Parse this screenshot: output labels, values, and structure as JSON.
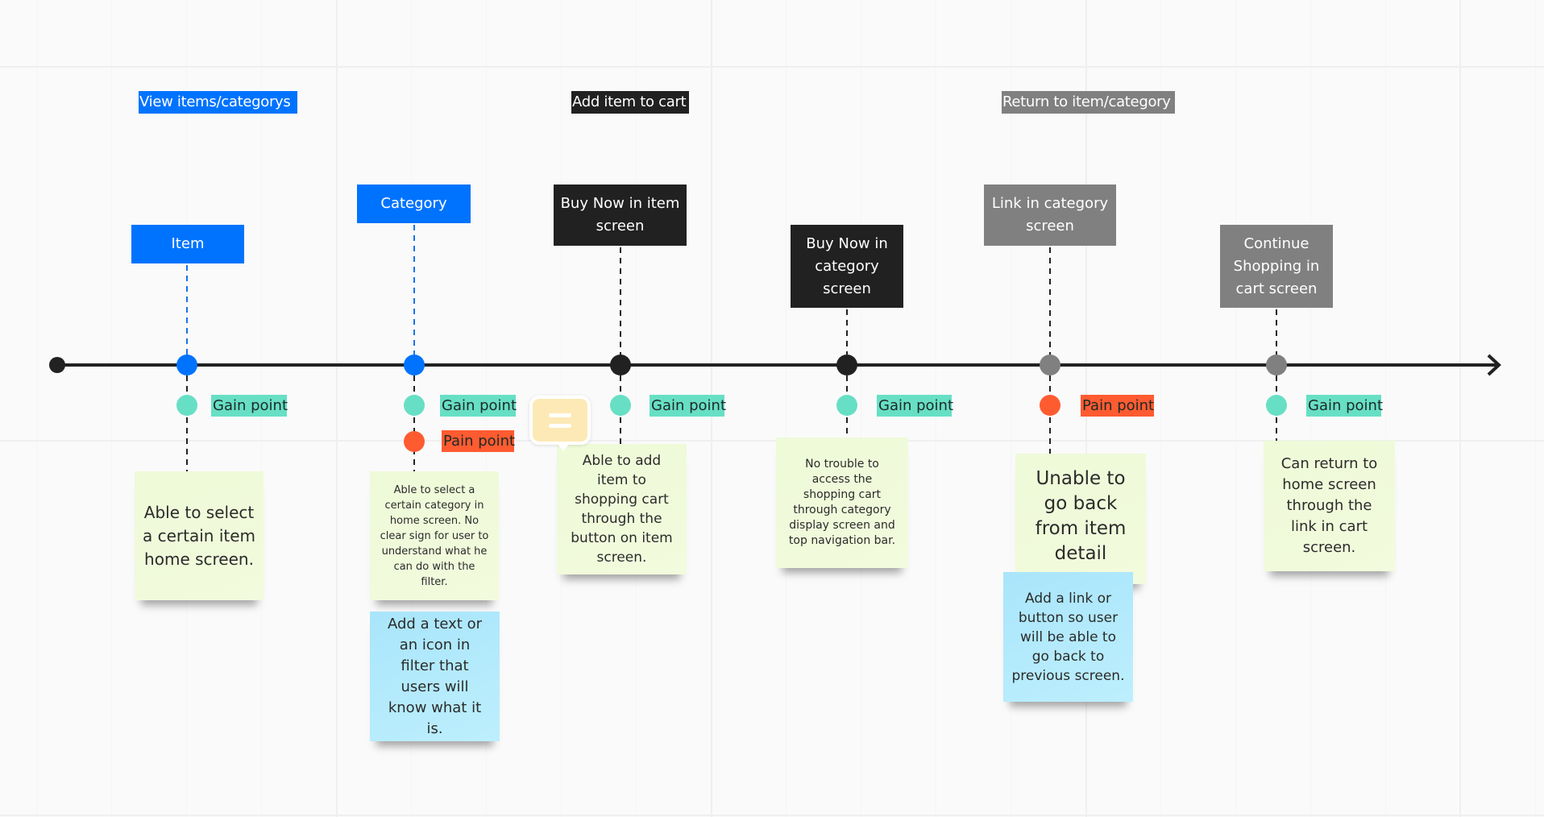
{
  "colors": {
    "blue": "#0073fe",
    "black": "#212121",
    "gray": "#808080",
    "gain": "#67dfc5",
    "pain": "#ff5b31",
    "sticky_green": "#eefad8",
    "sticky_blue": "#b3eafc",
    "comment": "#fde9b5"
  },
  "phases": [
    {
      "label": "View items/categorys",
      "color": "blue"
    },
    {
      "label": "Add item to cart",
      "color": "black"
    },
    {
      "label": "Return to item/category",
      "color": "gray"
    }
  ],
  "steps": [
    {
      "title": "Item",
      "color": "blue",
      "points": [
        {
          "type": "gain",
          "label": "Gain point"
        }
      ],
      "notes": [
        {
          "style": "green",
          "text": "Able to select a certain item home screen."
        }
      ]
    },
    {
      "title": "Category",
      "color": "blue",
      "points": [
        {
          "type": "gain",
          "label": "Gain point"
        },
        {
          "type": "pain",
          "label": "Pain point"
        }
      ],
      "notes": [
        {
          "style": "green",
          "text": "Able to select a certain category in home screen. No clear sign for user to understand what he can do with the filter."
        },
        {
          "style": "blue",
          "text": "Add a text or an icon in filter that users will know what it is."
        }
      ]
    },
    {
      "title": "Buy Now in item screen",
      "color": "black",
      "points": [
        {
          "type": "gain",
          "label": "Gain point"
        }
      ],
      "notes": [
        {
          "style": "green",
          "text": "Able to add item to shopping cart through the button on item screen."
        }
      ],
      "has_comment": true
    },
    {
      "title": "Buy Now in category screen",
      "color": "black",
      "points": [
        {
          "type": "gain",
          "label": "Gain point"
        }
      ],
      "notes": [
        {
          "style": "green",
          "text": "No trouble to access the shopping cart through category display screen and top navigation bar."
        }
      ]
    },
    {
      "title": "Link in category screen",
      "color": "gray",
      "points": [
        {
          "type": "pain",
          "label": "Pain point"
        }
      ],
      "notes": [
        {
          "style": "green",
          "text": "Unable to go back from item detail screen."
        },
        {
          "style": "blue",
          "text": "Add a link or button so user will be able to go back to previous screen."
        }
      ]
    },
    {
      "title": "Continue Shopping in cart screen",
      "color": "gray",
      "points": [
        {
          "type": "gain",
          "label": "Gain point"
        }
      ],
      "notes": [
        {
          "style": "green",
          "text": "Can return to home screen through the link in cart screen."
        }
      ]
    }
  ],
  "comment_icon": "comment-icon"
}
